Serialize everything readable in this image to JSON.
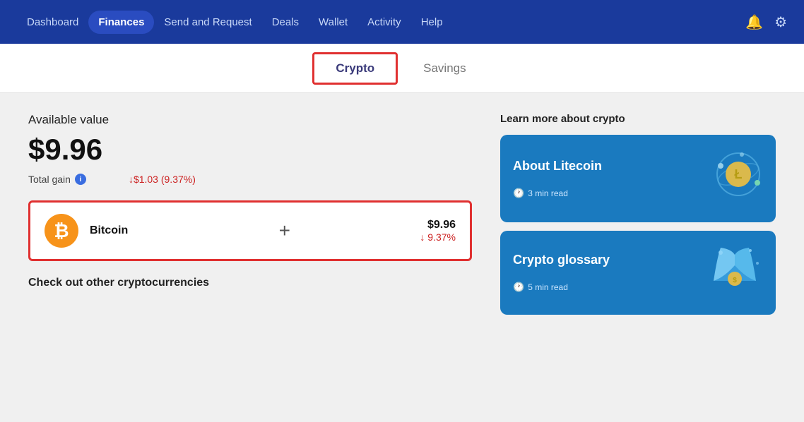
{
  "nav": {
    "items": [
      {
        "label": "Dashboard",
        "active": false
      },
      {
        "label": "Finances",
        "active": true
      },
      {
        "label": "Send and Request",
        "active": false
      },
      {
        "label": "Deals",
        "active": false
      },
      {
        "label": "Wallet",
        "active": false
      },
      {
        "label": "Activity",
        "active": false
      },
      {
        "label": "Help",
        "active": false
      }
    ]
  },
  "tabs": [
    {
      "label": "Crypto",
      "active": true
    },
    {
      "label": "Savings",
      "active": false
    }
  ],
  "main": {
    "available_label": "Available value",
    "big_value": "$9.96",
    "total_gain_label": "Total gain",
    "gain_value": "↓$1.03 (9.37%)",
    "coin": {
      "name": "Bitcoin",
      "usd": "$9.96",
      "pct": "↓ 9.37%"
    },
    "other_cryptos_label": "Check out other cryptocurrencies"
  },
  "right": {
    "learn_label": "Learn more about crypto",
    "cards": [
      {
        "title": "About Litecoin",
        "time": "3 min read"
      },
      {
        "title": "Crypto glossary",
        "time": "5 min read"
      }
    ]
  }
}
